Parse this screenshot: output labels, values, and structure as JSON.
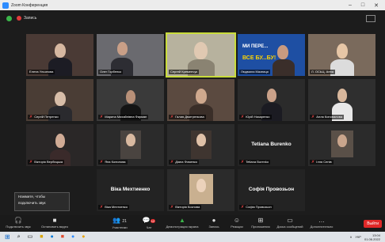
{
  "window": {
    "title": "Zoom Конференция",
    "minimize": "–",
    "maximize": "□",
    "close": "✕"
  },
  "infobar": {
    "recording_label": "Запись"
  },
  "participants": [
    {
      "name": "Елена Ульянова",
      "muted": false
    },
    {
      "name": "Олег Горбенко",
      "muted": false
    },
    {
      "name": "Сергей Кременчук",
      "muted": false
    },
    {
      "name": "Людмила Мазниця",
      "muted": false
    },
    {
      "name": "Л. ОСЬЦ. Анна",
      "muted": false
    },
    {
      "name": "Сергій Петренко",
      "muted": true
    },
    {
      "name": "Марина Михайлівна Фирман",
      "muted": true
    },
    {
      "name": "Галия Дмитренкова",
      "muted": true
    },
    {
      "name": "Юрій Назаренко",
      "muted": true
    },
    {
      "name": "Алла Коновалова",
      "muted": true
    },
    {
      "name": "Вікторія Вербицька",
      "muted": true
    },
    {
      "name": "Яна Копилова",
      "muted": true
    },
    {
      "name": "Діана Фоменко",
      "muted": true
    },
    {
      "name": "Tetiana Burenko",
      "muted": true,
      "center_label": "Tetiana Burenko"
    },
    {
      "name": "Ілля Сенів",
      "muted": true
    },
    {
      "name": "Віка Мехтиенко",
      "muted": true,
      "center_label": "Віка Мехтиенко"
    },
    {
      "name": "Вікторія Козлова",
      "muted": true
    },
    {
      "name": "Софія Провозьон",
      "muted": true,
      "center_label": "Софія Провозьон"
    }
  ],
  "banner": {
    "line1": "МИ ПЕРЕ...",
    "line2": "ВСЕ БУ...БУ!"
  },
  "tooltip": {
    "line1": "Нажмите, чтобы",
    "line2": "подключить звук"
  },
  "toolbar": {
    "audio": "Подключить звук",
    "video": "Остановить видео",
    "participants": "Участники",
    "participants_count": "21",
    "chat": "Чат",
    "chat_count": "12",
    "share": "Демонстрация экрана",
    "record": "Запись",
    "reactions": "Реакции",
    "apps": "Приложения",
    "whiteboard": "Доска сообщений",
    "more": "Дополнительно",
    "end": "Выйти"
  },
  "taskbar": {
    "time": "13:04",
    "date": "01.06.2022",
    "lang": "УКР"
  },
  "colors": {
    "accent": "#2d8cff",
    "highlight": "#c9dc3c",
    "end": "#e02828",
    "muted": "#e44444"
  }
}
